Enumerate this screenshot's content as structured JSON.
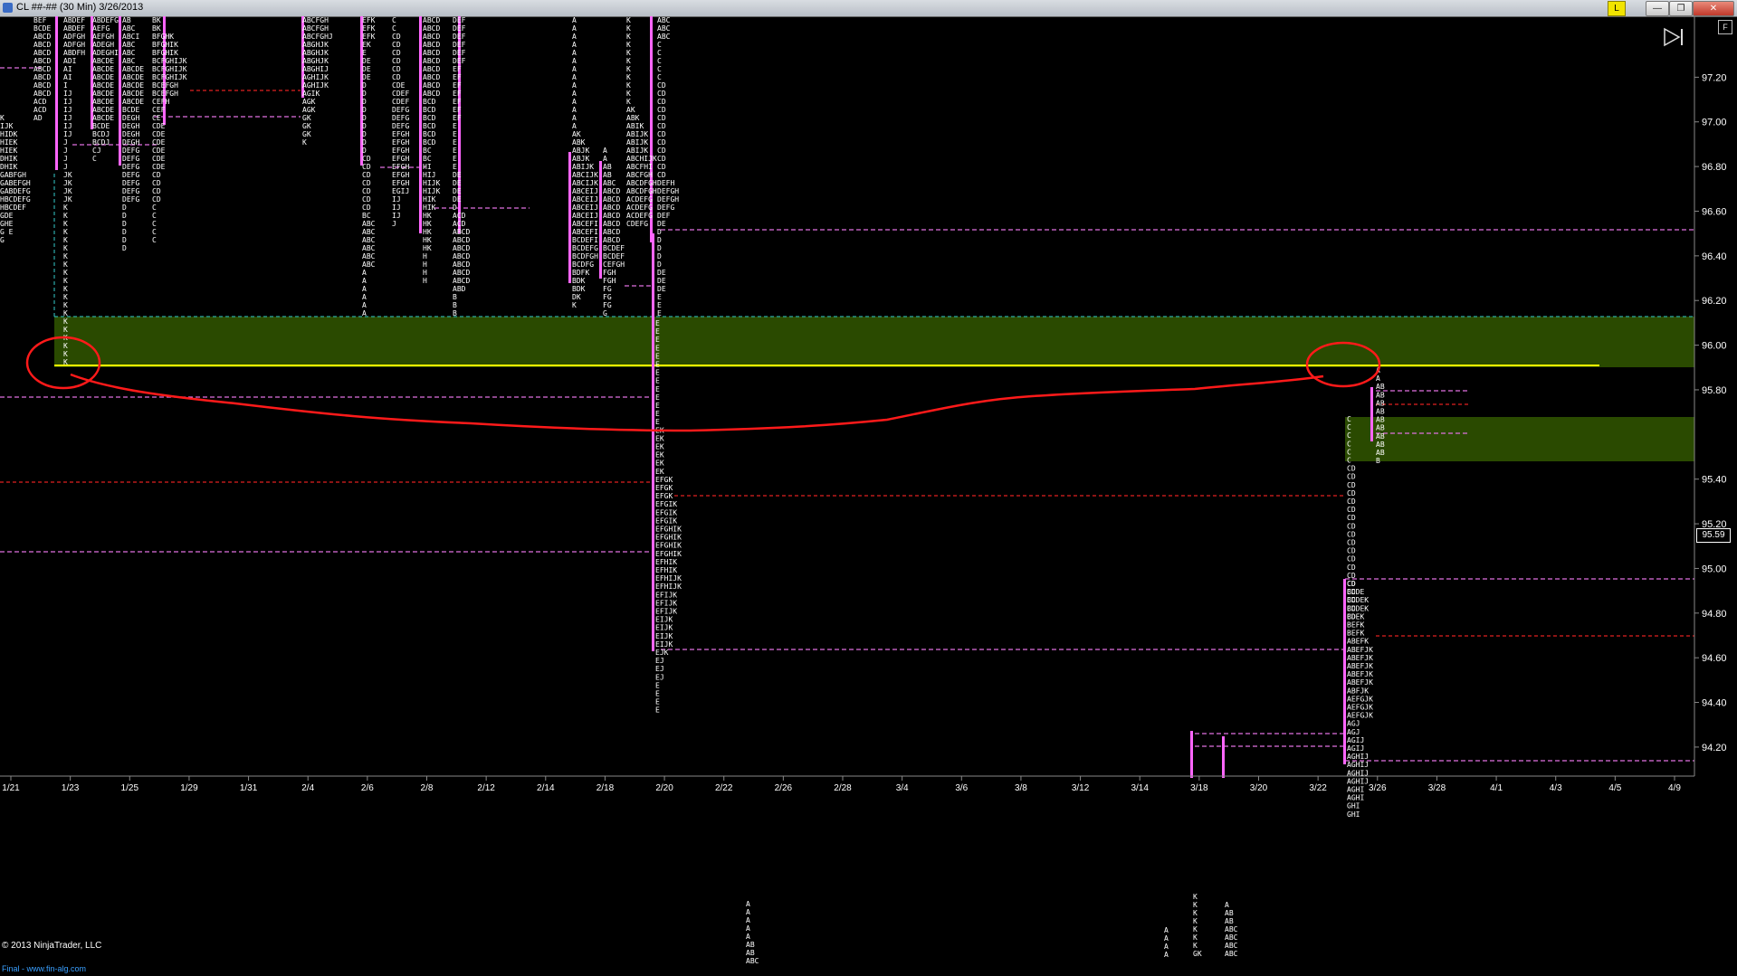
{
  "window": {
    "title": "CL ##-## (30 Min)  3/26/2013",
    "tag_button": "L"
  },
  "footer": {
    "copyright": "© 2013 NinjaTrader, LLC",
    "watermark": "Final - www.fin-alg.com"
  },
  "colors": {
    "background": "#000000",
    "profile_bar": "#ff66ff",
    "value_area_line": "#e070e0",
    "poc_line": "#e02020",
    "yellow_line": "#ffff00",
    "green_zone": "#2a4a00",
    "cyan_line": "#33cccc",
    "annotation": "#ff1a1a"
  },
  "current_price": "95.59",
  "chart_data": {
    "type": "table",
    "title": "",
    "instrument": "CL ##-##",
    "timeframe": "30 Min",
    "price_axis": {
      "ticks": [
        "97.20",
        "97.00",
        "96.80",
        "96.60",
        "96.40",
        "96.20",
        "96.00",
        "95.80",
        "95.40",
        "95.20",
        "95.00",
        "94.80",
        "94.60",
        "94.40",
        "94.20"
      ],
      "range": [
        94.07,
        97.4
      ]
    },
    "date_axis": {
      "ticks": [
        "1/21",
        "1/23",
        "1/25",
        "1/29",
        "1/31",
        "2/4",
        "2/6",
        "2/8",
        "2/12",
        "2/14",
        "2/18",
        "2/20",
        "2/22",
        "2/26",
        "2/28",
        "3/4",
        "3/6",
        "3/8",
        "3/12",
        "3/14",
        "3/18",
        "3/20",
        "3/22",
        "3/26",
        "3/28",
        "4/1",
        "4/3",
        "4/5",
        "4/9"
      ]
    },
    "reference_lines": [
      {
        "kind": "yellow",
        "price": 95.9
      },
      {
        "kind": "green_zone",
        "from": 95.9,
        "to": 96.11
      },
      {
        "kind": "green_zone",
        "from": 95.5,
        "to": 95.69
      },
      {
        "kind": "cyan_dashed",
        "price": 96.11
      }
    ],
    "profile_letters": {
      "feb20_upper": [
        "E",
        "E",
        "E",
        "E",
        "E",
        "E",
        "E",
        "E",
        "E",
        "E",
        "E",
        "E",
        "E",
        "EK",
        "EK",
        "EK",
        "EK",
        "EK",
        "EK",
        "EFGK",
        "EFGK",
        "EFGK",
        "EFGIK",
        "EFGIK",
        "EFGIK",
        "EFGHIK",
        "EFGHIK",
        "EFGHIK",
        "EFGHIK",
        "EFHIK",
        "EFHIK",
        "EFHIJK",
        "EFHIJK",
        "EFIJK",
        "EFIJK",
        "EFIJK",
        "EIJK",
        "EIJK",
        "EIJK",
        "EIJK",
        "EJK",
        "EJ",
        "EJ",
        "EJ",
        "E",
        "E",
        "E",
        "E"
      ],
      "mar22_upper": [
        "C",
        "C",
        "C",
        "C",
        "C",
        "C",
        "CD",
        "CD",
        "CD",
        "CD",
        "CD",
        "CD",
        "CD",
        "CD",
        "CD",
        "CD",
        "CD",
        "CD",
        "CD",
        "CD",
        "CD",
        "CD",
        "CD",
        "CD",
        "CD"
      ],
      "mar22_lower": [
        "CD",
        "BCDE",
        "BCDEK",
        "BCDEK",
        "BDEK",
        "BEFK",
        "BEFK",
        "ABEFK",
        "ABEFJK",
        "ABEFJK",
        "ABEFJK",
        "ABEFJK",
        "ABEFJK",
        "ABFJK",
        "AEFGJK",
        "AEFGJK",
        "AEFGJK",
        "AGJ",
        "AGJ",
        "AGIJ",
        "AGIJ",
        "AGHIJ",
        "AGHIJ",
        "AGHIJ",
        "AGHIJ",
        "AGHI",
        "AGHI",
        "GHI",
        "GHI"
      ],
      "mar25": [
        "A",
        "A",
        "AB",
        "AB",
        "AB",
        "AB",
        "AB",
        "AB",
        "AB",
        "AB",
        "AB",
        "B"
      ]
    }
  }
}
